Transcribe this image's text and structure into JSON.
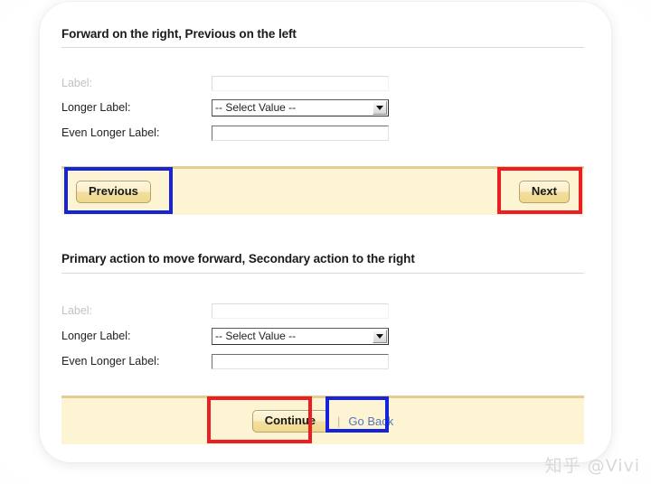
{
  "sections": [
    {
      "heading": "Forward on the right, Previous on the left",
      "fields": [
        {
          "label": "Label:",
          "type": "text",
          "value": "",
          "placeholder": ""
        },
        {
          "label": "Longer Label:",
          "type": "select",
          "value": "-- Select Value --"
        },
        {
          "label": "Even Longer Label:",
          "type": "text",
          "value": "",
          "placeholder": ""
        }
      ],
      "actions": {
        "left_button": "Previous",
        "right_button": "Next"
      }
    },
    {
      "heading": "Primary action to move forward, Secondary action to the right",
      "fields": [
        {
          "label": "Label:",
          "type": "text",
          "value": "",
          "placeholder": ""
        },
        {
          "label": "Longer Label:",
          "type": "select",
          "value": "-- Select Value --"
        },
        {
          "label": "Even Longer Label:",
          "type": "text",
          "value": "",
          "placeholder": ""
        }
      ],
      "actions": {
        "primary_button": "Continue",
        "separator": "|",
        "secondary_link": "Go Back"
      }
    }
  ],
  "annotations": {
    "blue_ring_color": "#1524D8",
    "red_ring_color": "#EC1D24"
  },
  "watermark": "知乎 @Vivi"
}
